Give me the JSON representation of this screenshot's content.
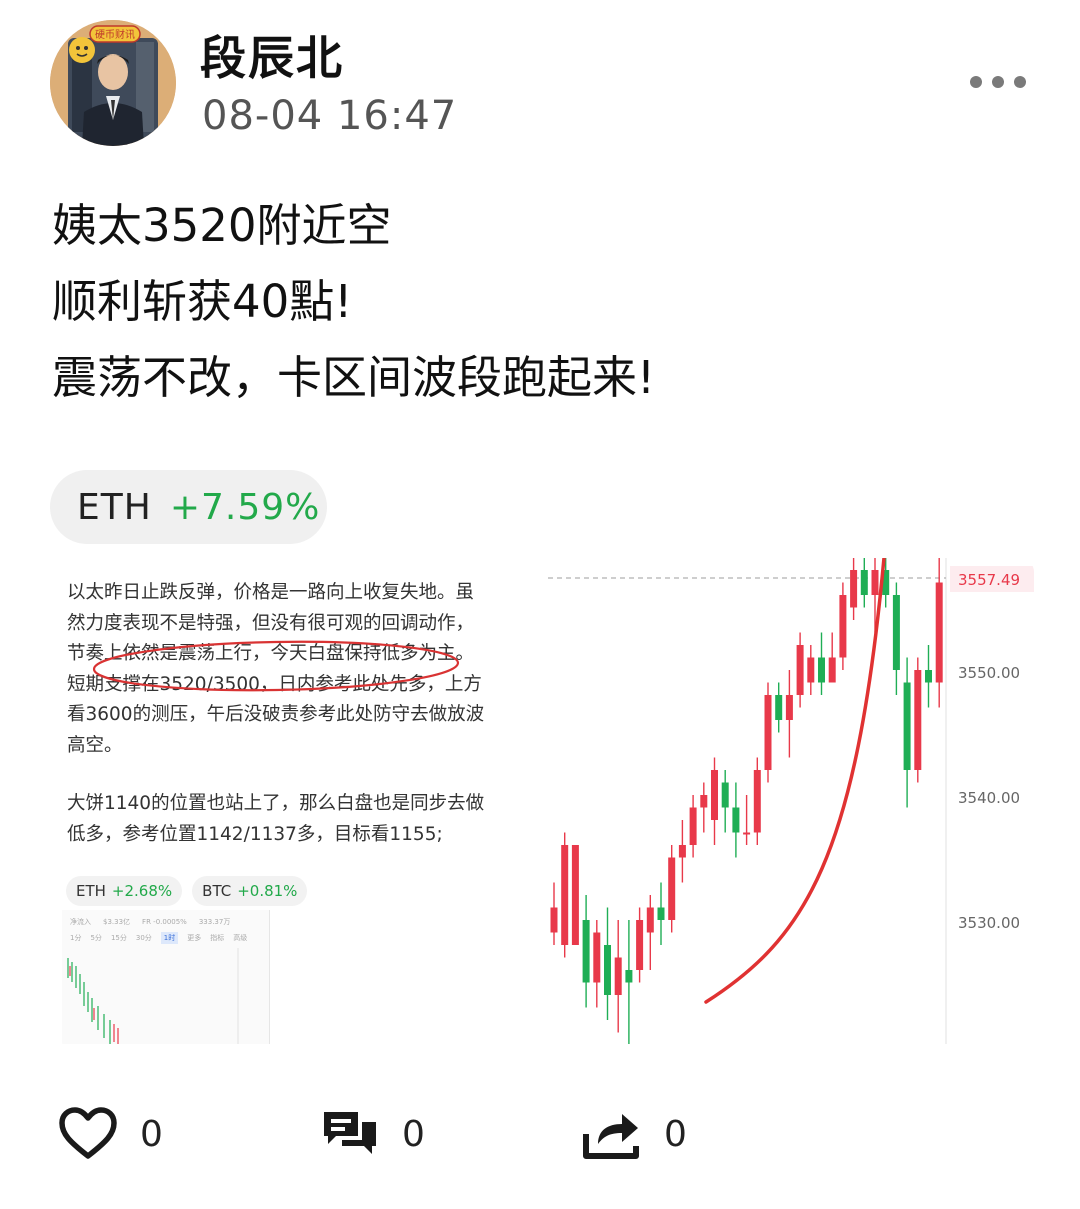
{
  "author": {
    "name": "段辰北",
    "timestamp": "08-04 16:47",
    "avatar_badge": "硬币财讯"
  },
  "post": {
    "lines": [
      "姨太3520附近空",
      "顺利斩获40點!",
      "震荡不改，卡区间波段跑起来!"
    ]
  },
  "ticker": {
    "symbol": "ETH",
    "change": "+7.59%",
    "change_color": "#22a94a"
  },
  "image": {
    "analysis_lines_1": [
      "以太昨日止跌反弹，价格是一路向上收复失地。虽",
      "然力度表现不是特强，但没有很可观的回调动作，",
      "节奏上依然是震荡上行，今天白盘保持低多为主。",
      "短期支撑在3520/3500，日内参考此处先多，上方",
      "看3600的测压，午后没破责参考此处防守去做放波",
      "高空。"
    ],
    "analysis_lines_2": [
      "大饼1140的位置也站上了，那么白盘也是同步去做",
      "低多，参考位置1142/1137多，目标看1155;"
    ],
    "mini_chips": [
      {
        "symbol": "ETH",
        "change": "+2.68%"
      },
      {
        "symbol": "BTC",
        "change": "+0.81%"
      }
    ],
    "mini_screenshot": {
      "row1": [
        "净流入",
        "$3.33亿",
        "FR -0.0005%",
        "333.37万"
      ],
      "tabs": [
        "1分",
        "5分",
        "15分",
        "30分",
        "1时",
        "更多",
        "指标",
        "高级"
      ]
    }
  },
  "chart_data": {
    "type": "candlestick",
    "y_ticks": [
      "3557.49",
      "3550.00",
      "3540.00",
      "3530.00"
    ],
    "current_price": "3557.49",
    "ylim": [
      3518,
      3559
    ],
    "up_color": "#e8394a",
    "down_color": "#1fae55",
    "candles": [
      {
        "o": 3529,
        "h": 3533,
        "l": 3528,
        "c": 3531
      },
      {
        "o": 3528,
        "h": 3537,
        "l": 3527,
        "c": 3536
      },
      {
        "o": 3528,
        "h": 3536,
        "l": 3528,
        "c": 3536
      },
      {
        "o": 3530,
        "h": 3532,
        "l": 3523,
        "c": 3525
      },
      {
        "o": 3525,
        "h": 3530,
        "l": 3523,
        "c": 3529
      },
      {
        "o": 3528,
        "h": 3531,
        "l": 3522,
        "c": 3524
      },
      {
        "o": 3524,
        "h": 3530,
        "l": 3521,
        "c": 3527
      },
      {
        "o": 3526,
        "h": 3530,
        "l": 3520,
        "c": 3525
      },
      {
        "o": 3526,
        "h": 3531,
        "l": 3525,
        "c": 3530
      },
      {
        "o": 3529,
        "h": 3532,
        "l": 3526,
        "c": 3531
      },
      {
        "o": 3531,
        "h": 3533,
        "l": 3528,
        "c": 3530
      },
      {
        "o": 3530,
        "h": 3536,
        "l": 3529,
        "c": 3535
      },
      {
        "o": 3535,
        "h": 3538,
        "l": 3533,
        "c": 3536
      },
      {
        "o": 3536,
        "h": 3540,
        "l": 3535,
        "c": 3539
      },
      {
        "o": 3539,
        "h": 3541,
        "l": 3537,
        "c": 3540
      },
      {
        "o": 3538,
        "h": 3543,
        "l": 3536,
        "c": 3542
      },
      {
        "o": 3541,
        "h": 3542,
        "l": 3537,
        "c": 3539
      },
      {
        "o": 3539,
        "h": 3541,
        "l": 3535,
        "c": 3537
      },
      {
        "o": 3537,
        "h": 3540,
        "l": 3536,
        "c": 3537
      },
      {
        "o": 3537,
        "h": 3543,
        "l": 3536,
        "c": 3542
      },
      {
        "o": 3542,
        "h": 3549,
        "l": 3541,
        "c": 3548
      },
      {
        "o": 3548,
        "h": 3549,
        "l": 3545,
        "c": 3546
      },
      {
        "o": 3546,
        "h": 3550,
        "l": 3543,
        "c": 3548
      },
      {
        "o": 3548,
        "h": 3553,
        "l": 3547,
        "c": 3552
      },
      {
        "o": 3549,
        "h": 3552,
        "l": 3548,
        "c": 3551
      },
      {
        "o": 3551,
        "h": 3553,
        "l": 3548,
        "c": 3549
      },
      {
        "o": 3549,
        "h": 3553,
        "l": 3549,
        "c": 3551
      },
      {
        "o": 3551,
        "h": 3557,
        "l": 3550,
        "c": 3556
      },
      {
        "o": 3555,
        "h": 3559,
        "l": 3554,
        "c": 3558
      },
      {
        "o": 3558,
        "h": 3559,
        "l": 3555,
        "c": 3556
      },
      {
        "o": 3556,
        "h": 3559,
        "l": 3553,
        "c": 3558
      },
      {
        "o": 3558,
        "h": 3559,
        "l": 3555,
        "c": 3556
      },
      {
        "o": 3556,
        "h": 3557,
        "l": 3548,
        "c": 3550
      },
      {
        "o": 3549,
        "h": 3551,
        "l": 3539,
        "c": 3542
      },
      {
        "o": 3542,
        "h": 3551,
        "l": 3541,
        "c": 3550
      },
      {
        "o": 3550,
        "h": 3552,
        "l": 3547,
        "c": 3549
      },
      {
        "o": 3549,
        "h": 3559,
        "l": 3547,
        "c": 3557
      }
    ]
  },
  "actions": {
    "like_count": "0",
    "comment_count": "0",
    "share_count": "0"
  }
}
